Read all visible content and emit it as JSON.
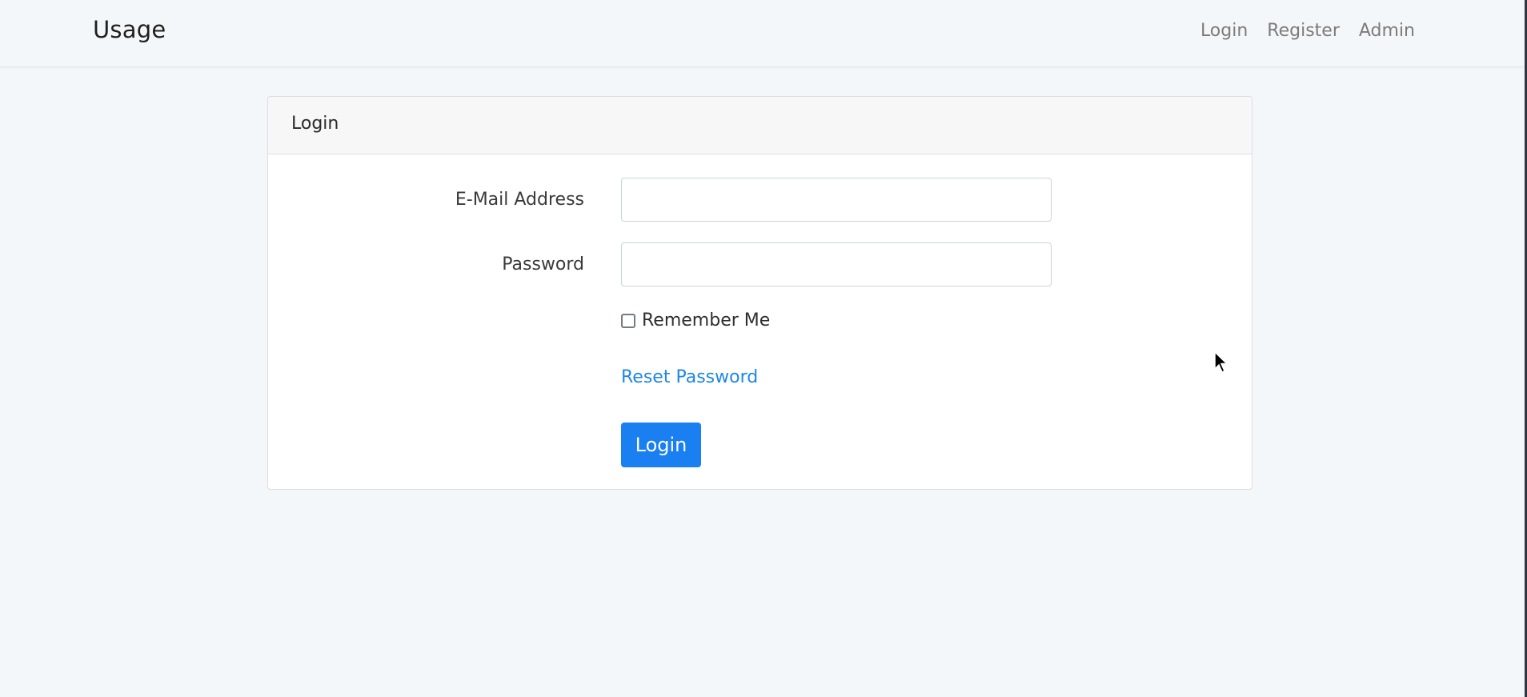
{
  "navbar": {
    "brand": "Usage",
    "links": [
      {
        "label": "Login"
      },
      {
        "label": "Register"
      },
      {
        "label": "Admin"
      }
    ]
  },
  "login_card": {
    "header": "Login",
    "email": {
      "label": "E-Mail Address",
      "value": "",
      "placeholder": ""
    },
    "password": {
      "label": "Password",
      "value": "",
      "placeholder": ""
    },
    "remember": {
      "label": "Remember Me",
      "checked": false
    },
    "reset_link": "Reset Password",
    "submit_label": "Login"
  },
  "colors": {
    "background": "#f4f7fa",
    "primary": "#1a7ff0",
    "link": "#1e88e5"
  },
  "icons": {
    "cursor": "mouse-pointer-icon"
  }
}
